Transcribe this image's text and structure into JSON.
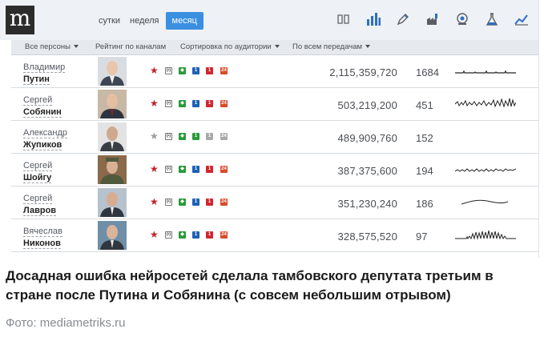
{
  "app": {
    "logo_letter": "m"
  },
  "periods": [
    "сутки",
    "неделя",
    "месяц"
  ],
  "active_period": "месяц",
  "toolbar_icons": [
    "compare-icon",
    "bar-chart-icon",
    "pen-icon",
    "factory-icon",
    "globe-icon",
    "flask-icon",
    "trend-icon"
  ],
  "filters": {
    "persons": "Все персоны",
    "ranking": "Рейтинг по каналам",
    "sort": "Сортировка по аудитории",
    "programs": "По всем передачам"
  },
  "channel_badges": [
    "(•)",
    "◆",
    "1",
    "1",
    "24"
  ],
  "rows": [
    {
      "first": "Владимир",
      "last": "Путин",
      "audience": "2,115,359,720",
      "count": "1684",
      "active": true
    },
    {
      "first": "Сергей",
      "last": "Собянин",
      "audience": "503,219,200",
      "count": "451",
      "active": true
    },
    {
      "first": "Александр",
      "last": "Жупиков",
      "audience": "489,909,760",
      "count": "152",
      "active": false
    },
    {
      "first": "Сергей",
      "last": "Шойгу",
      "audience": "387,375,600",
      "count": "194",
      "active": true
    },
    {
      "first": "Сергей",
      "last": "Лавров",
      "audience": "351,230,240",
      "count": "186",
      "active": true
    },
    {
      "first": "Вячеслав",
      "last": "Никонов",
      "audience": "328,575,520",
      "count": "97",
      "active": true
    }
  ],
  "caption": "Досадная ошибка нейросетей сделала тамбовского депутата третьим в стране после Путина и Собянина (с совсем небольшим отрывом)",
  "credit": "Фото:  mediametriks.ru",
  "colors": {
    "accent": "#3b8fe0",
    "star": "#c0242b",
    "first_channel": "#2a9a3a",
    "russia1": "#d22630"
  }
}
